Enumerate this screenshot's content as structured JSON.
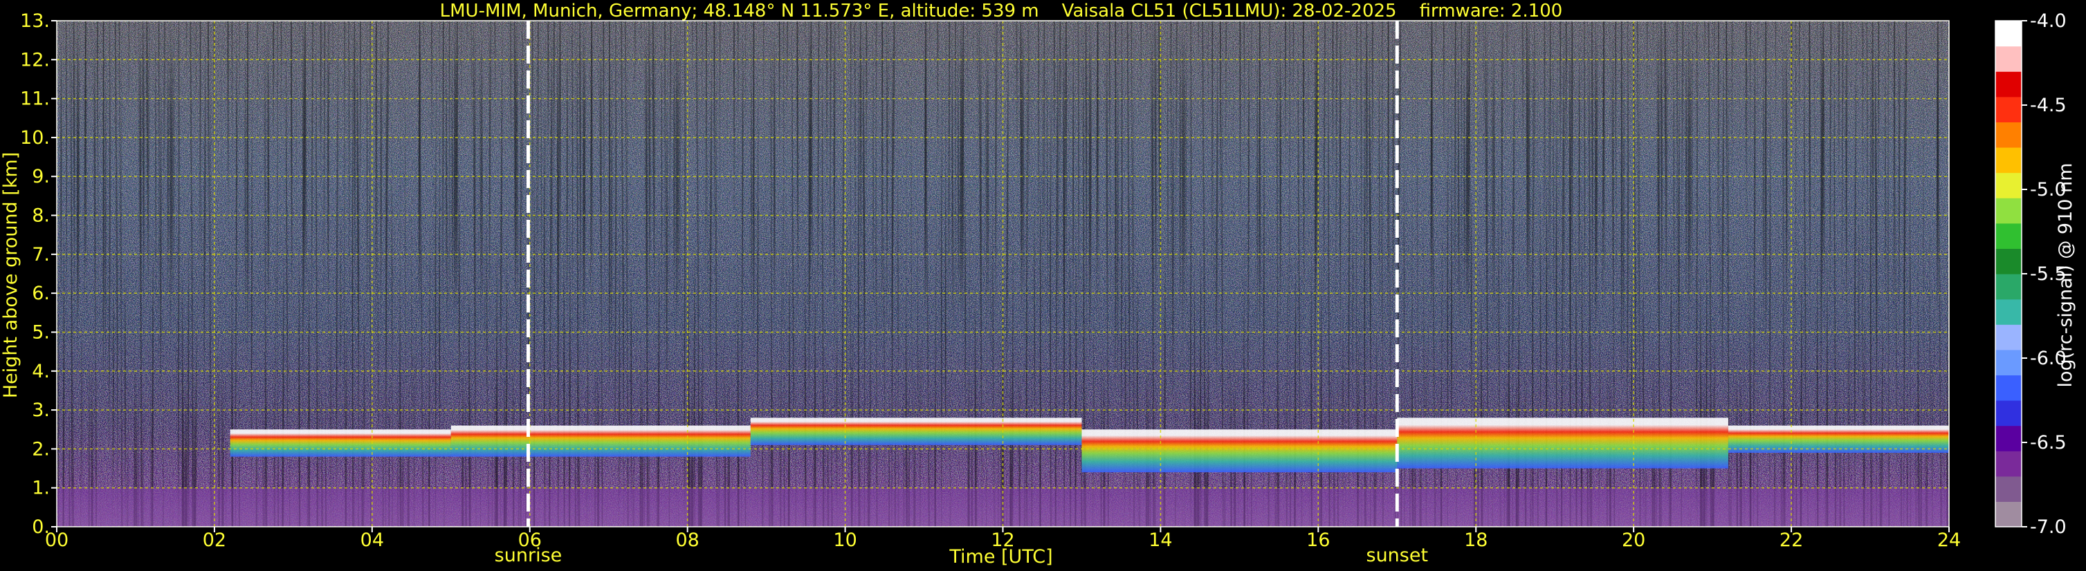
{
  "chart_data": {
    "type": "heatmap",
    "title": "LMU-MIM, Munich, Germany; 48.148° N 11.573° E, altitude: 539 m    Vaisala CL51 (CL51LMU): 28-02-2025    firmware: 2.100",
    "xlabel": "Time [UTC]",
    "ylabel": "Height above ground [km]",
    "xlim": [
      0,
      24
    ],
    "ylim": [
      0,
      13
    ],
    "x_ticks": [
      "00",
      "02",
      "04",
      "06",
      "08",
      "10",
      "12",
      "14",
      "16",
      "18",
      "20",
      "22",
      "24"
    ],
    "y_ticks": [
      "0.",
      "1.",
      "2.",
      "3.",
      "4.",
      "5.",
      "6.",
      "7.",
      "8.",
      "9.",
      "10.",
      "11.",
      "12.",
      "13."
    ],
    "grid": true,
    "colorbar": {
      "label": "log(rc-signal) @ 910 nm",
      "range": [
        -7.0,
        -4.0
      ],
      "ticks": [
        "-4.0",
        "-4.5",
        "-5.0",
        "-5.5",
        "-6.0",
        "-6.5",
        "-7.0"
      ],
      "tick_values": [
        -4.0,
        -4.5,
        -5.0,
        -5.5,
        -6.0,
        -6.5,
        -7.0
      ],
      "colors": [
        "#a08ca0",
        "#805a90",
        "#7a2a9a",
        "#5a00a0",
        "#3030e0",
        "#3a60ff",
        "#6a9aff",
        "#9ab4ff",
        "#38b8a8",
        "#2aa868",
        "#1a8a2a",
        "#30c030",
        "#90e040",
        "#e8f030",
        "#ffc000",
        "#ff8000",
        "#ff3010",
        "#e00000",
        "#ffc0c0",
        "#ffffff"
      ]
    },
    "events": [
      {
        "label": "sunrise",
        "time": 5.98
      },
      {
        "label": "sunset",
        "time": 17.0
      }
    ],
    "cloud_layers": [
      {
        "start": 2.2,
        "end": 5.0,
        "base_km": 1.8,
        "top_km": 2.5
      },
      {
        "start": 5.0,
        "end": 8.8,
        "base_km": 1.8,
        "top_km": 2.6
      },
      {
        "start": 8.8,
        "end": 13.0,
        "base_km": 2.1,
        "top_km": 2.8
      },
      {
        "start": 13.0,
        "end": 17.0,
        "base_km": 1.4,
        "top_km": 2.5
      },
      {
        "start": 17.0,
        "end": 21.2,
        "base_km": 1.5,
        "top_km": 2.8
      },
      {
        "start": 21.2,
        "end": 24.0,
        "base_km": 1.9,
        "top_km": 2.6
      }
    ]
  }
}
